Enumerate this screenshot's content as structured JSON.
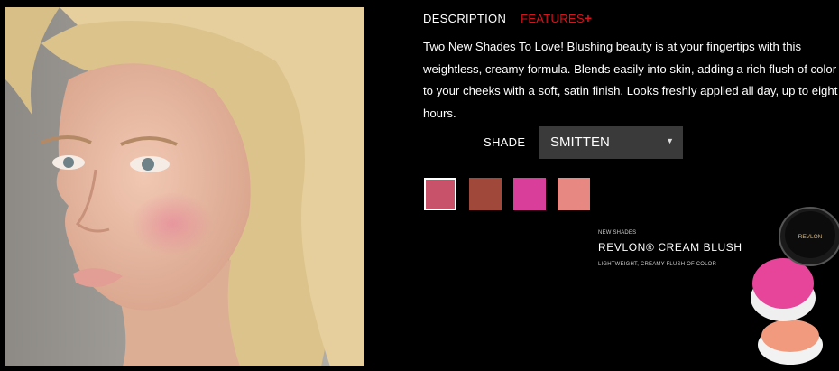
{
  "tabs": {
    "description": "DESCRIPTION",
    "features": "FEATURES",
    "features_plus": "+"
  },
  "description_text": "Two New Shades To Love! Blushing beauty is at your fingertips with this weightless, creamy formula. Blends easily into skin, adding a rich flush of color to your cheeks with a soft, satin finish. Looks freshly applied all day, up to eight hours.",
  "shade": {
    "label": "SHADE",
    "selected": "SMITTEN",
    "swatches": [
      "#c8526a",
      "#a0483a",
      "#d93f9a",
      "#e88882"
    ]
  },
  "promo": {
    "small": "NEW SHADES",
    "title": "REVLON® CREAM BLUSH",
    "subtitle": "LIGHTWEIGHT, CREAMY FLUSH OF COLOR",
    "product_logo": "REVLON"
  },
  "colors": {
    "accent": "#d6141c",
    "select_bg": "#3a3a3a"
  }
}
